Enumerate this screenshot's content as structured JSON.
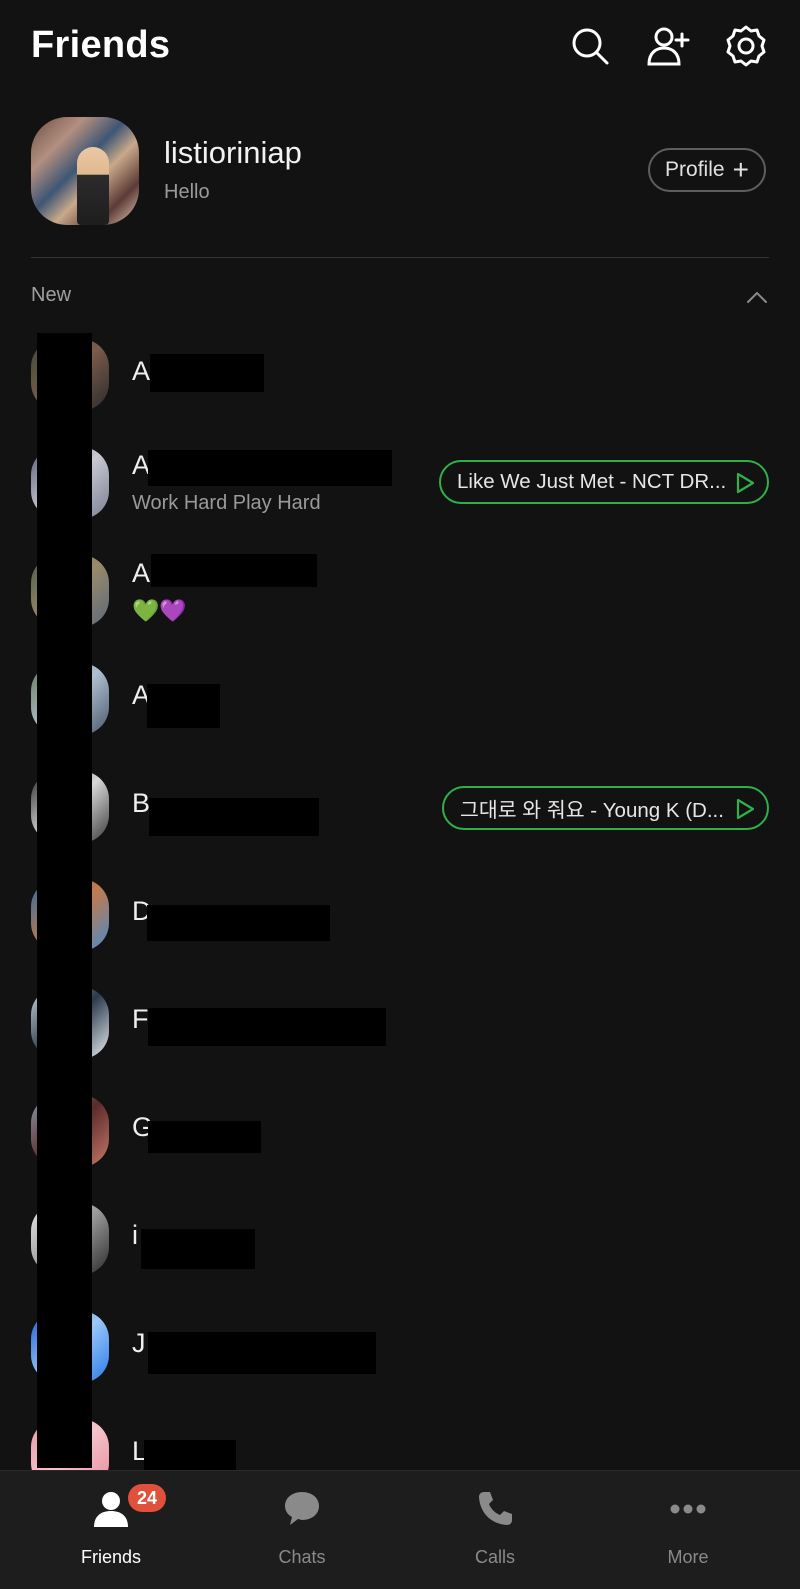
{
  "header": {
    "title": "Friends",
    "icons": [
      "search-icon",
      "add-friend-icon",
      "settings-icon"
    ]
  },
  "me": {
    "name": "listioriniap",
    "status": "Hello",
    "profile_button": "Profile"
  },
  "section": {
    "label": "New"
  },
  "friends": [
    {
      "name": "A",
      "sub": "",
      "music": ""
    },
    {
      "name": "A",
      "sub": "Work Hard Play Hard",
      "music": "Like We Just Met - NCT DR..."
    },
    {
      "name": "A",
      "sub": "💚💜",
      "music": ""
    },
    {
      "name": "A",
      "sub": "",
      "music": ""
    },
    {
      "name": "B",
      "sub": "",
      "music": "그대로 와 줘요 - Young K (D..."
    },
    {
      "name": "D",
      "sub": "",
      "music": ""
    },
    {
      "name": "F",
      "sub": "",
      "music": ""
    },
    {
      "name": "G",
      "sub": "",
      "music": ""
    },
    {
      "name": "i",
      "sub": "",
      "music": ""
    },
    {
      "name": "J",
      "sub": "",
      "music": ""
    },
    {
      "name": "L",
      "sub": "",
      "music": ""
    }
  ],
  "tabbar": {
    "tabs": [
      {
        "label": "Friends",
        "icon": "person-icon",
        "badge": "24",
        "active": true
      },
      {
        "label": "Chats",
        "icon": "chat-bubble-icon"
      },
      {
        "label": "Calls",
        "icon": "phone-icon"
      },
      {
        "label": "More",
        "icon": "more-dots-icon"
      }
    ]
  },
  "colors": {
    "background": "#121212",
    "music_border": "#2fb14a",
    "badge": "#e0503a"
  }
}
